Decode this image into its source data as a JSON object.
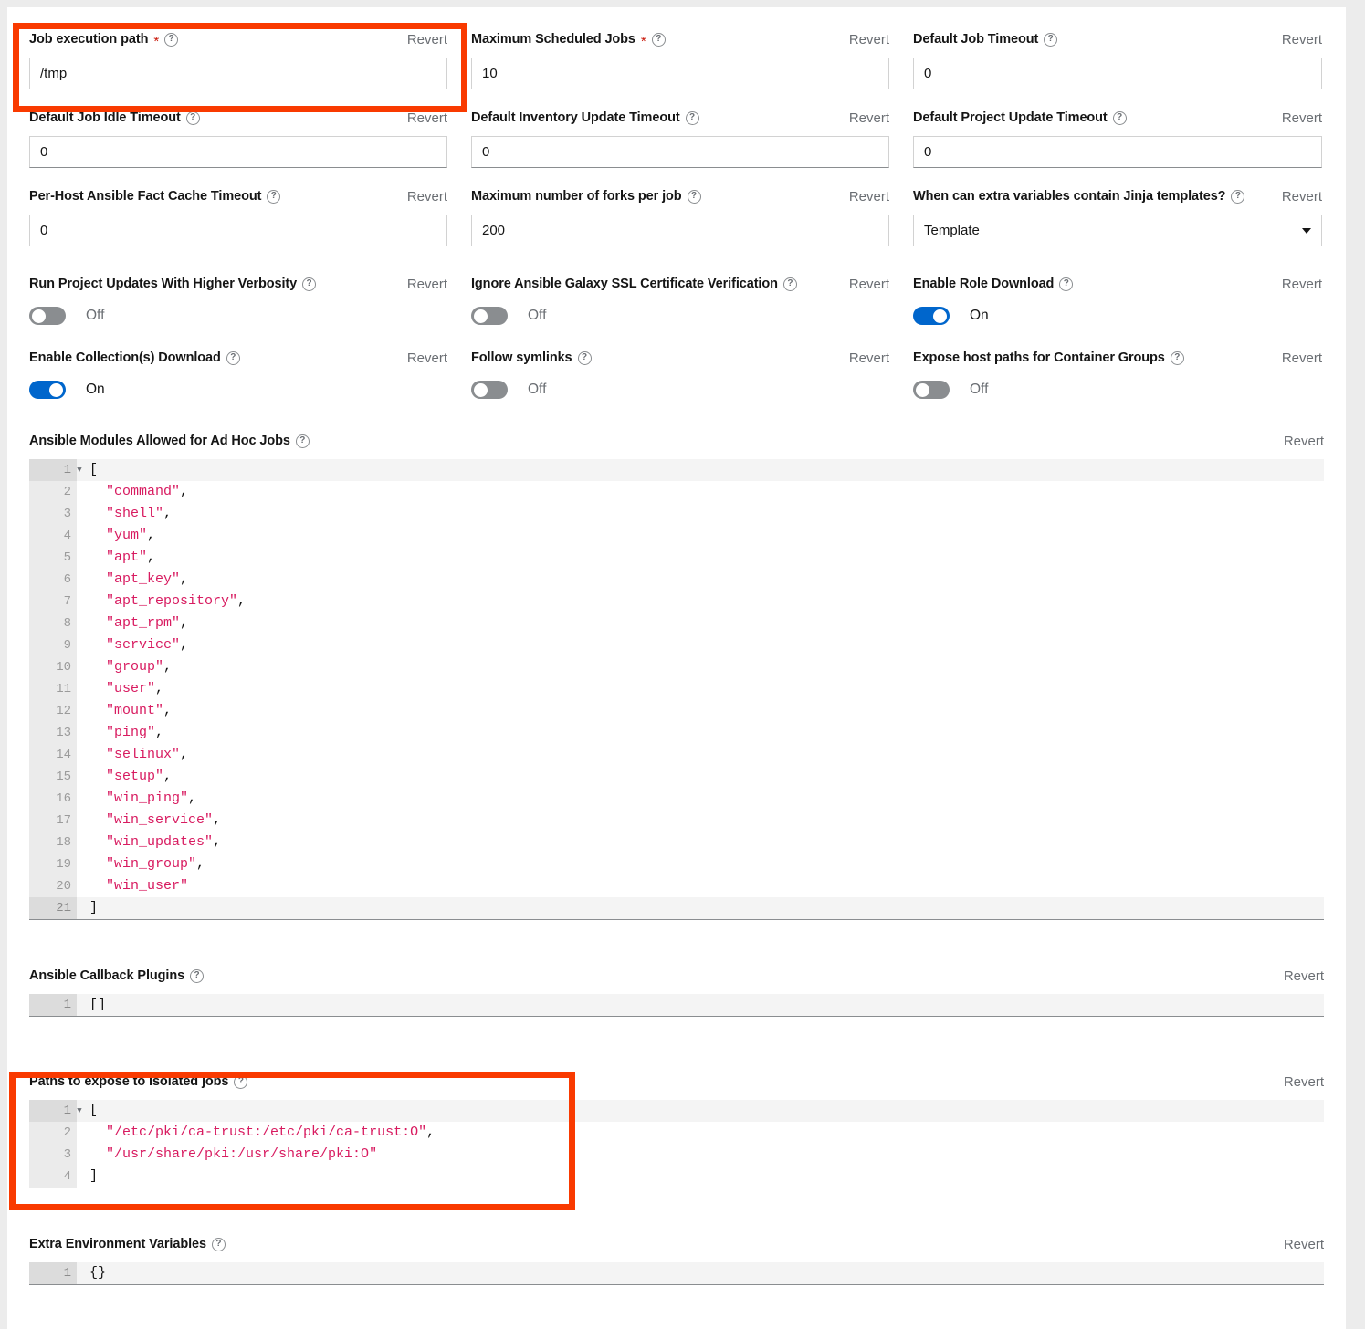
{
  "colors": {
    "accent_toggle_on": "#0066cc",
    "toggle_off": "#8a8d90",
    "required_asterisk": "#c9190b",
    "annotation_box": "#f93a00",
    "code_string": "#d81b60",
    "label_text": "#151515",
    "muted_text": "#6a6e73"
  },
  "common": {
    "revert_label": "Revert",
    "help_icon": "help-circle-icon",
    "required_marker": "*",
    "on_label": "On",
    "off_label": "Off"
  },
  "fields": {
    "job_execution_path": {
      "label": "Job execution path",
      "required": true,
      "value": "/tmp",
      "revert": "Revert",
      "highlighted": true
    },
    "maximum_scheduled_jobs": {
      "label": "Maximum Scheduled Jobs",
      "required": true,
      "value": "10",
      "revert": "Revert"
    },
    "default_job_timeout": {
      "label": "Default Job Timeout",
      "required": false,
      "value": "0",
      "revert": "Revert"
    },
    "default_job_idle_timeout": {
      "label": "Default Job Idle Timeout",
      "required": false,
      "value": "0",
      "revert": "Revert"
    },
    "default_inventory_update_timeout": {
      "label": "Default Inventory Update Timeout",
      "required": false,
      "value": "0",
      "revert": "Revert"
    },
    "default_project_update_timeout": {
      "label": "Default Project Update Timeout",
      "required": false,
      "value": "0",
      "revert": "Revert"
    },
    "per_host_fact_cache_timeout": {
      "label": "Per-Host Ansible Fact Cache Timeout",
      "required": false,
      "value": "0",
      "revert": "Revert"
    },
    "maximum_forks_per_job": {
      "label": "Maximum number of forks per job",
      "required": false,
      "value": "200",
      "revert": "Revert"
    },
    "jinja_templates": {
      "label": "When can extra variables contain Jinja templates?",
      "required": false,
      "value": "Template",
      "revert": "Revert"
    }
  },
  "toggles": {
    "run_project_updates_verbosity": {
      "label": "Run Project Updates With Higher Verbosity",
      "state": "Off",
      "on": false,
      "revert": "Revert"
    },
    "ignore_galaxy_ssl": {
      "label": "Ignore Ansible Galaxy SSL Certificate Verification",
      "state": "Off",
      "on": false,
      "revert": "Revert"
    },
    "enable_role_download": {
      "label": "Enable Role Download",
      "state": "On",
      "on": true,
      "revert": "Revert"
    },
    "enable_collections_download": {
      "label": "Enable Collection(s) Download",
      "state": "On",
      "on": true,
      "revert": "Revert"
    },
    "follow_symlinks": {
      "label": "Follow symlinks",
      "state": "Off",
      "on": false,
      "revert": "Revert"
    },
    "expose_host_paths": {
      "label": "Expose host paths for Container Groups",
      "state": "Off",
      "on": false,
      "revert": "Revert"
    }
  },
  "editors": {
    "ansible_modules": {
      "label": "Ansible Modules Allowed for Ad Hoc Jobs",
      "revert": "Revert",
      "lines": [
        {
          "n": "1",
          "text": "[",
          "fold": true,
          "active": true
        },
        {
          "n": "2",
          "text": "  \"command\",",
          "fold": false,
          "active": false
        },
        {
          "n": "3",
          "text": "  \"shell\",",
          "fold": false,
          "active": false
        },
        {
          "n": "4",
          "text": "  \"yum\",",
          "fold": false,
          "active": false
        },
        {
          "n": "5",
          "text": "  \"apt\",",
          "fold": false,
          "active": false
        },
        {
          "n": "6",
          "text": "  \"apt_key\",",
          "fold": false,
          "active": false
        },
        {
          "n": "7",
          "text": "  \"apt_repository\",",
          "fold": false,
          "active": false
        },
        {
          "n": "8",
          "text": "  \"apt_rpm\",",
          "fold": false,
          "active": false
        },
        {
          "n": "9",
          "text": "  \"service\",",
          "fold": false,
          "active": false
        },
        {
          "n": "10",
          "text": "  \"group\",",
          "fold": false,
          "active": false
        },
        {
          "n": "11",
          "text": "  \"user\",",
          "fold": false,
          "active": false
        },
        {
          "n": "12",
          "text": "  \"mount\",",
          "fold": false,
          "active": false
        },
        {
          "n": "13",
          "text": "  \"ping\",",
          "fold": false,
          "active": false
        },
        {
          "n": "14",
          "text": "  \"selinux\",",
          "fold": false,
          "active": false
        },
        {
          "n": "15",
          "text": "  \"setup\",",
          "fold": false,
          "active": false
        },
        {
          "n": "16",
          "text": "  \"win_ping\",",
          "fold": false,
          "active": false
        },
        {
          "n": "17",
          "text": "  \"win_service\",",
          "fold": false,
          "active": false
        },
        {
          "n": "18",
          "text": "  \"win_updates\",",
          "fold": false,
          "active": false
        },
        {
          "n": "19",
          "text": "  \"win_group\",",
          "fold": false,
          "active": false
        },
        {
          "n": "20",
          "text": "  \"win_user\"",
          "fold": false,
          "active": false
        },
        {
          "n": "21",
          "text": "]",
          "fold": false,
          "active": true
        }
      ]
    },
    "ansible_callback_plugins": {
      "label": "Ansible Callback Plugins",
      "revert": "Revert",
      "lines": [
        {
          "n": "1",
          "text": "[]",
          "fold": false,
          "active": true
        }
      ]
    },
    "paths_to_expose": {
      "label": "Paths to expose to isolated jobs",
      "revert": "Revert",
      "highlighted": true,
      "lines": [
        {
          "n": "1",
          "text": "[",
          "fold": true,
          "active": true
        },
        {
          "n": "2",
          "text": "  \"/etc/pki/ca-trust:/etc/pki/ca-trust:O\",",
          "fold": false,
          "active": false
        },
        {
          "n": "3",
          "text": "  \"/usr/share/pki:/usr/share/pki:O\"",
          "fold": false,
          "active": false
        },
        {
          "n": "4",
          "text": "]",
          "fold": false,
          "active": false
        }
      ]
    },
    "extra_environment_variables": {
      "label": "Extra Environment Variables",
      "revert": "Revert",
      "lines": [
        {
          "n": "1",
          "text": "{}",
          "fold": false,
          "active": true
        }
      ]
    }
  }
}
